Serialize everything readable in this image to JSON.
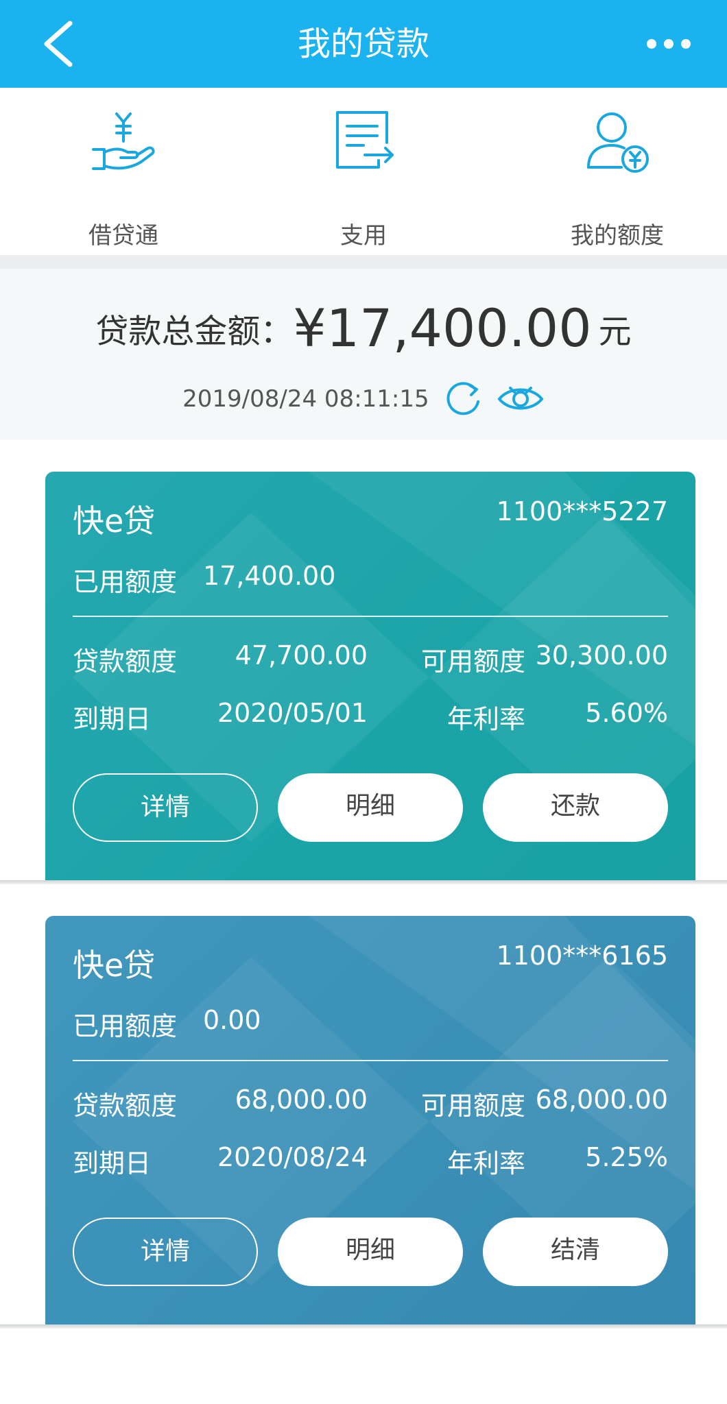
{
  "header": {
    "title": "我的贷款",
    "back_icon": "chevron-left-icon",
    "more_icon": "more-dots-icon"
  },
  "shortcuts": [
    {
      "label": "借贷通",
      "icon": "hand-yen-icon"
    },
    {
      "label": "支用",
      "icon": "document-arrow-icon"
    },
    {
      "label": "我的额度",
      "icon": "user-yen-icon"
    }
  ],
  "summary": {
    "label": "贷款总金额：",
    "amount": "¥17,400.00",
    "unit": "元",
    "timestamp": "2019/08/24 08:11:15"
  },
  "loans": [
    {
      "name": "快e贷",
      "account": "1100***5227",
      "used_label": "已用额度",
      "used_value": "17,400.00",
      "limit_label": "贷款额度",
      "limit_value": "47,700.00",
      "avail_label": "可用额度",
      "avail_value": "30,300.00",
      "due_label": "到期日",
      "due_value": "2020/05/01",
      "rate_label": "年利率",
      "rate_value": "5.60%",
      "btn_details": "详情",
      "btn_history": "明细",
      "btn_action": "还款"
    },
    {
      "name": "快e贷",
      "account": "1100***6165",
      "used_label": "已用额度",
      "used_value": "0.00",
      "limit_label": "贷款额度",
      "limit_value": "68,000.00",
      "avail_label": "可用额度",
      "avail_value": "68,000.00",
      "due_label": "到期日",
      "due_value": "2020/08/24",
      "rate_label": "年利率",
      "rate_value": "5.25%",
      "btn_details": "详情",
      "btn_history": "明细",
      "btn_action": "结清"
    }
  ],
  "colors": {
    "header": "#1ab3ef",
    "card1": "#1aa4a8",
    "card2": "#3a8fb6",
    "accent": "#1aa7df"
  }
}
